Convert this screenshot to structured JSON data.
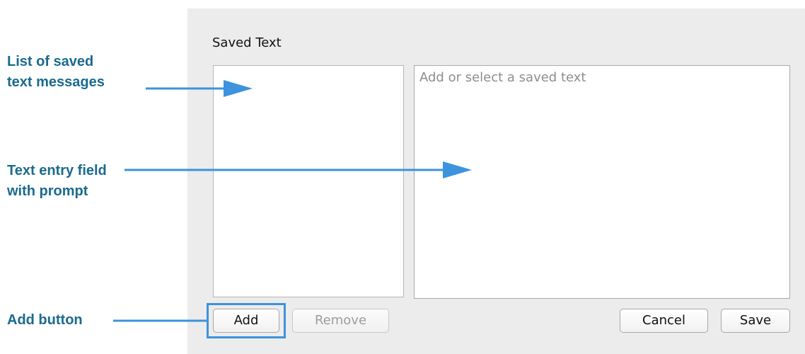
{
  "dialog": {
    "title": "Saved Text",
    "text_field": {
      "value": "",
      "placeholder": "Add or select a saved text"
    },
    "buttons": {
      "add": "Add",
      "remove": "Remove",
      "cancel": "Cancel",
      "save": "Save"
    }
  },
  "callouts": {
    "list": [
      "List of saved",
      "text messages"
    ],
    "field": [
      "Text entry field",
      "with prompt"
    ],
    "add": "Add button"
  },
  "colors": {
    "callout_text": "#1a6a8f",
    "arrow": "#3d93dd",
    "panel_bg": "#ececec"
  }
}
